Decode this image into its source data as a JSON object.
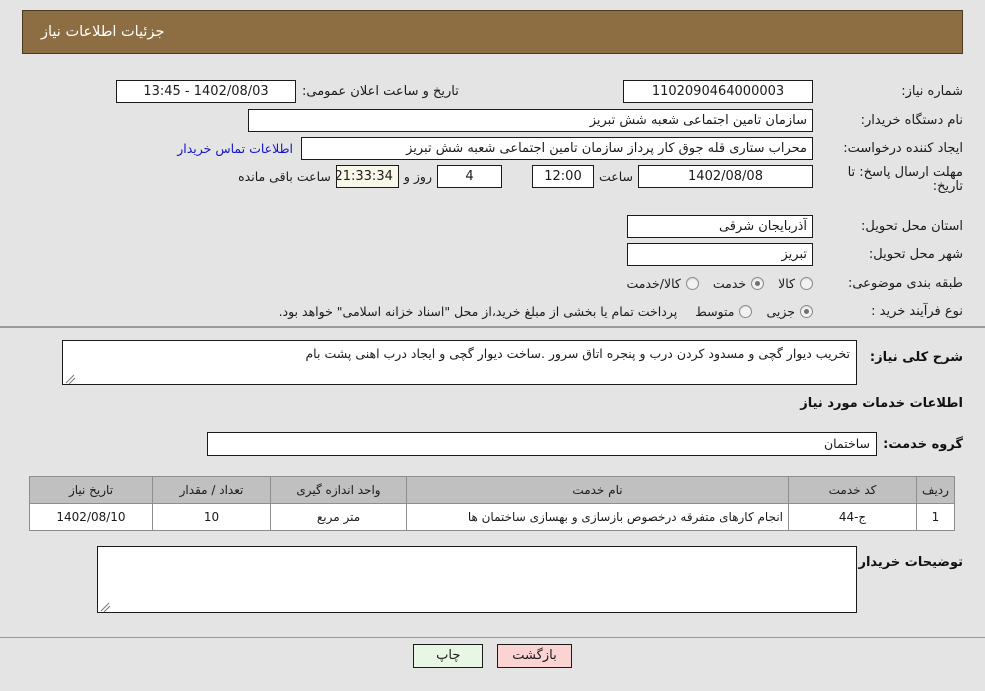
{
  "header": {
    "title": "جزئیات اطلاعات نیاز"
  },
  "colors": {
    "header_brown": "#8D6E43",
    "page_bg": "#E4E4E4",
    "table_header_gray": "#C0C0C0",
    "link_blue": "#1414C8",
    "btn_print_green": "#E8F6E4",
    "btn_back_pink": "#FBD3D3",
    "countdown_cream": "#FAF8E8"
  },
  "form": {
    "need_number_label": "شماره نیاز:",
    "need_number_value": "1102090464000003",
    "announce_label": "تاریخ و ساعت اعلان عمومی:",
    "announce_value": "1402/08/03 - 13:45",
    "buyer_org_label": "نام دستگاه خریدار:",
    "buyer_org_value": "سازمان تامین اجتماعی شعبه شش تبریز",
    "creator_label": "ایجاد کننده درخواست:",
    "creator_value": "محراب ستاری قله جوق کار پرداز سازمان تامین اجتماعی شعبه شش تبریز",
    "contact_link": "اطلاعات تماس خریدار",
    "deadline_label": "مهلت ارسال پاسخ: تا تاریخ:",
    "deadline_date": "1402/08/08",
    "hour_label": "ساعت",
    "deadline_time": "12:00",
    "days_value": "4",
    "days_label": "روز و",
    "countdown_value": "21:33:34",
    "remaining_label": "ساعت باقی مانده",
    "province_label": "استان محل تحویل:",
    "province_value": "آذربایجان شرقی",
    "city_label": "شهر محل تحویل:",
    "city_value": "تبریز",
    "category_label": "طبقه بندی موضوعی:",
    "category_options": [
      {
        "label": "کالا",
        "selected": false
      },
      {
        "label": "خدمت",
        "selected": true
      },
      {
        "label": "کالا/خدمت",
        "selected": false
      }
    ],
    "process_label": "نوع فرآیند خرید :",
    "process_options": [
      {
        "label": "جزیی",
        "selected": true
      },
      {
        "label": "متوسط",
        "selected": false
      }
    ],
    "payment_note": "پرداخت تمام یا بخشی از مبلغ خرید،از محل \"اسناد خزانه اسلامی\" خواهد بود."
  },
  "details": {
    "general_desc_label": "شرح کلی نیاز:",
    "general_desc_value": "تخریب دیوار گچی و مسدود کردن درب و پنجره اتاق سرور .ساخت دیوار گچی و ایجاد درب اهنی پشت بام",
    "services_title": "اطلاعات خدمات مورد نیاز",
    "service_group_label": "گروه خدمت:",
    "service_group_value": "ساختمان",
    "buyer_notes_label": "توضیحات خریدار:",
    "buyer_notes_value": ""
  },
  "table": {
    "columns": [
      "ردیف",
      "کد خدمت",
      "نام خدمت",
      "واحد اندازه گیری",
      "تعداد / مقدار",
      "تاریخ نیاز"
    ],
    "rows": [
      {
        "row": "1",
        "code": "ج-44",
        "name": "انجام کارهای متفرقه درخصوص بازسازی و بهسازی ساختمان ها",
        "unit": "متر مربع",
        "quantity": "10",
        "date": "1402/08/10"
      }
    ]
  },
  "buttons": {
    "print": "چاپ",
    "back": "بازگشت"
  }
}
